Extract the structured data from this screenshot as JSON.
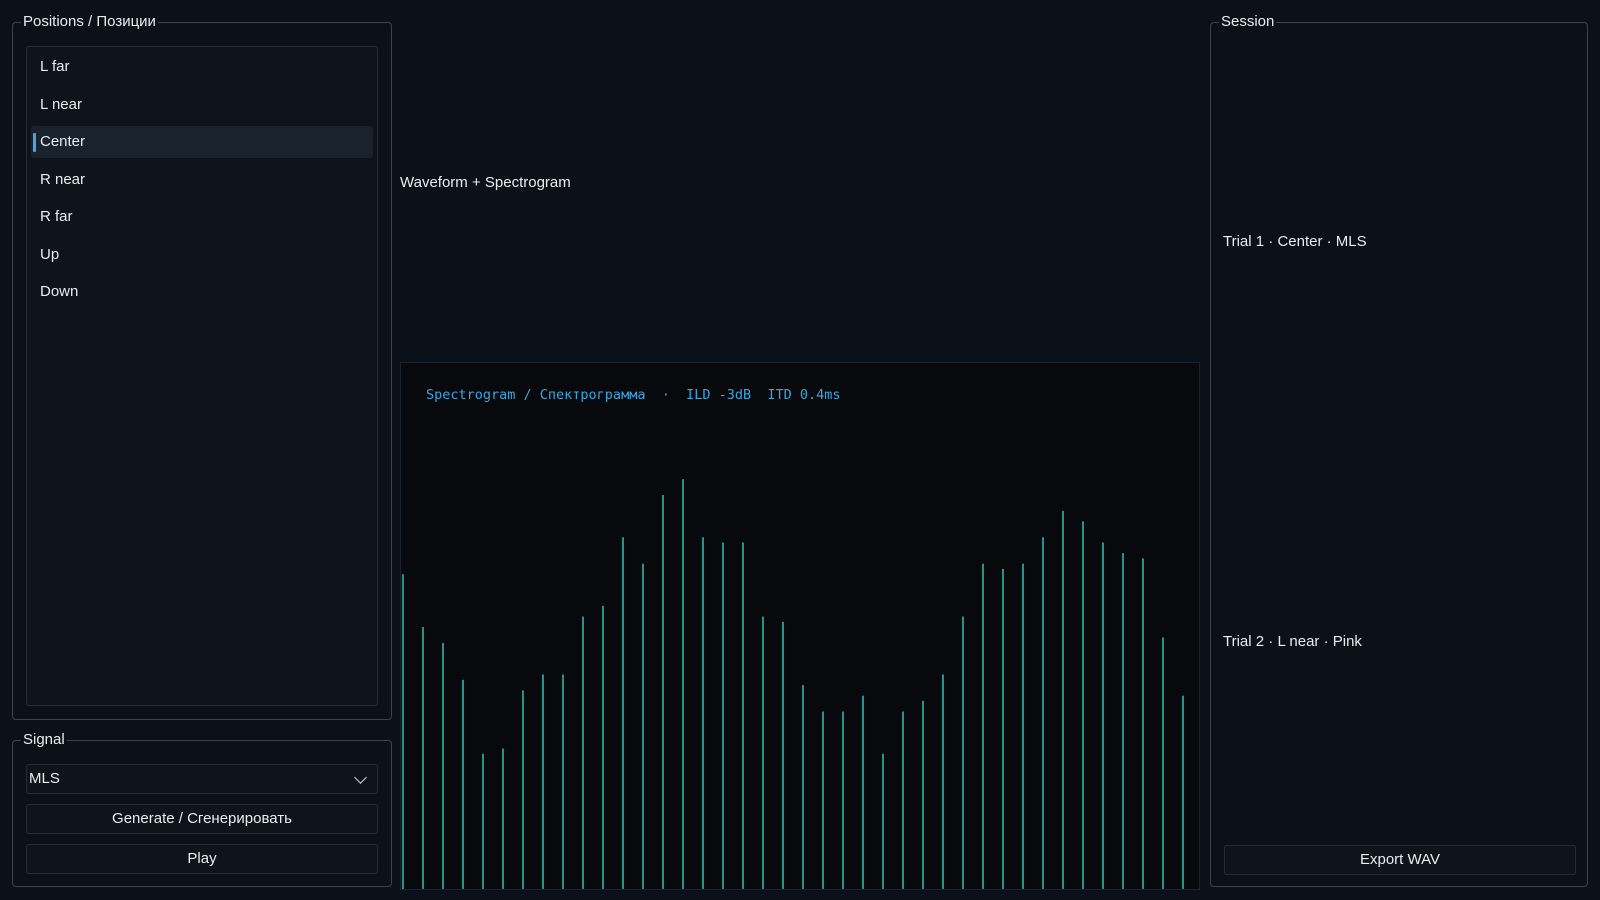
{
  "positions": {
    "title": "Positions / Позиции",
    "items": [
      {
        "label": "L far",
        "selected": false
      },
      {
        "label": "L near",
        "selected": false
      },
      {
        "label": "Center",
        "selected": true
      },
      {
        "label": "R near",
        "selected": false
      },
      {
        "label": "R far",
        "selected": false
      },
      {
        "label": "Up",
        "selected": false
      },
      {
        "label": "Down",
        "selected": false
      }
    ]
  },
  "signal": {
    "title": "Signal",
    "selected": "MLS",
    "generate_label": "Generate / Сгенерировать",
    "play_label": "Play"
  },
  "viewer": {
    "waveform_label": "Waveform + Spectrogram",
    "spectrogram_title": "Spectrogram / Спектрограмма  ·  ILD -3dB  ITD 0.4ms",
    "bar_color": "#2ab8a8",
    "title_color": "#3aa6e0",
    "bar_levels": [
      0.6,
      0.5,
      0.47,
      0.4,
      0.26,
      0.27,
      0.38,
      0.41,
      0.41,
      0.52,
      0.54,
      0.67,
      0.62,
      0.75,
      0.78,
      0.67,
      0.66,
      0.66,
      0.52,
      0.51,
      0.39,
      0.34,
      0.34,
      0.37,
      0.26,
      0.34,
      0.36,
      0.41,
      0.52,
      0.62,
      0.61,
      0.62,
      0.67,
      0.72,
      0.7,
      0.66,
      0.64,
      0.63,
      0.48,
      0.37
    ]
  },
  "session": {
    "title": "Session",
    "trials": [
      "Trial 1 · Center · MLS",
      "Trial 2 · L near · Pink"
    ],
    "export_label": "Export WAV"
  }
}
